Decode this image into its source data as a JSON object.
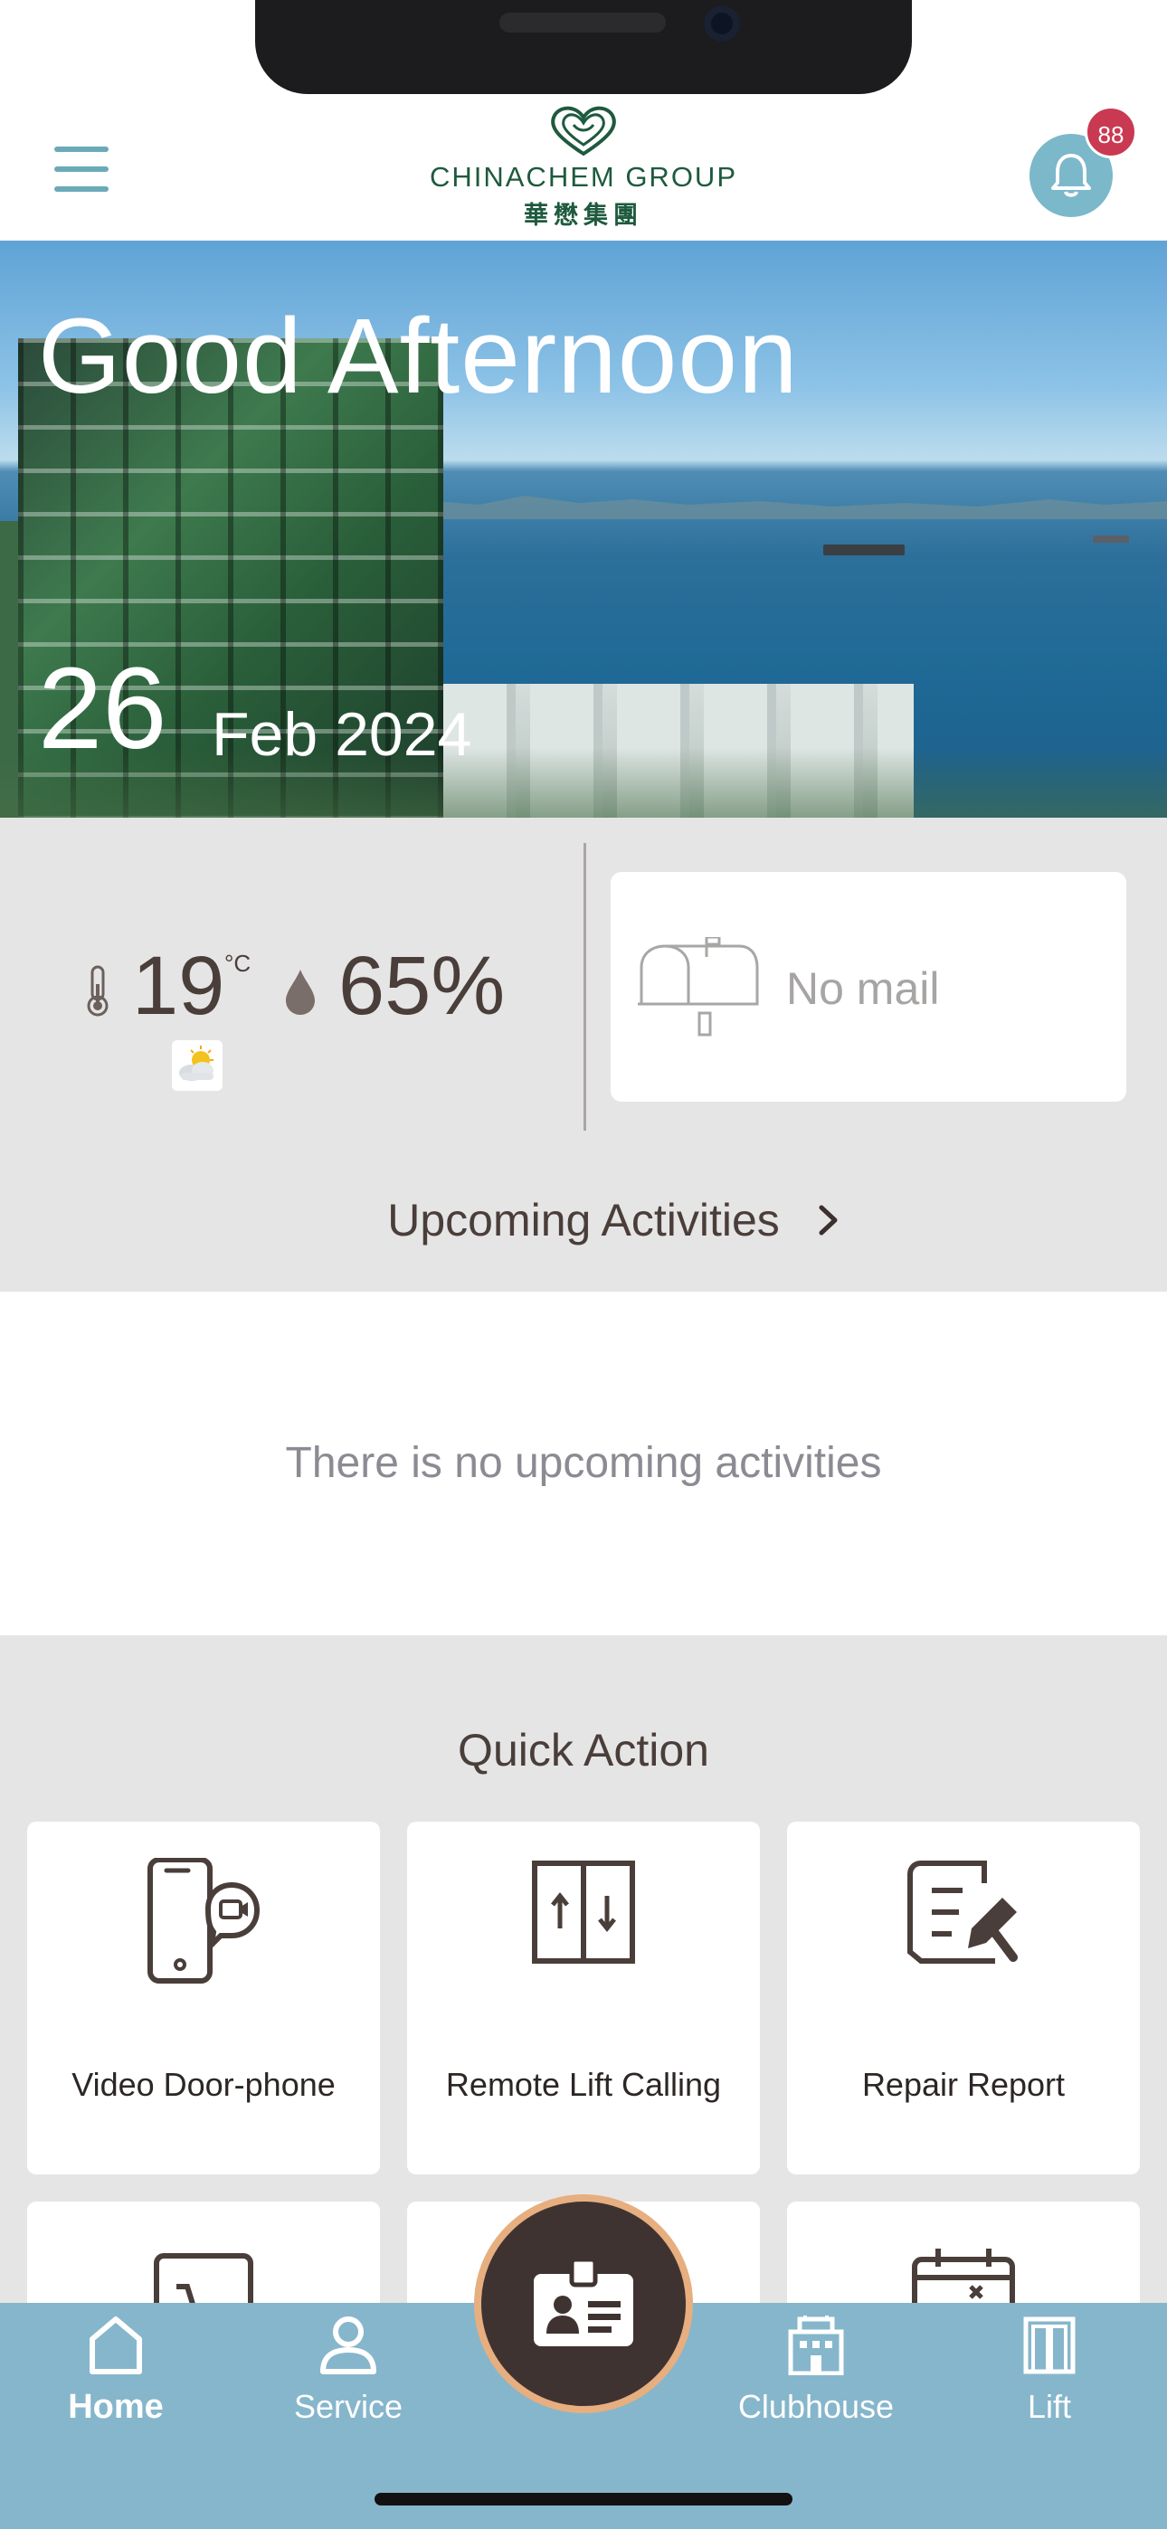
{
  "header": {
    "logo_en": "CHINACHEM GROUP",
    "logo_zh": "華懋集團",
    "notification_count": "88"
  },
  "hero": {
    "greeting": "Good Afternoon",
    "day": "26",
    "month_year": "Feb 2024"
  },
  "weather": {
    "temperature": "19",
    "temperature_unit": "°C",
    "humidity": "65%",
    "condition_icon": "partly-cloudy-icon"
  },
  "mail": {
    "status": "No mail"
  },
  "activities": {
    "title": "Upcoming Activities",
    "empty_message": "There is no upcoming activities"
  },
  "quick_action": {
    "title": "Quick Action",
    "items": [
      {
        "label": "Video Door-phone",
        "icon": "video-door-phone-icon"
      },
      {
        "label": "Remote Lift Calling",
        "icon": "lift-call-icon"
      },
      {
        "label": "Repair Report",
        "icon": "repair-report-icon"
      },
      {
        "label": "",
        "icon": "shopping-cart-icon"
      },
      {
        "label": "",
        "icon": "unknown-icon"
      },
      {
        "label": "",
        "icon": "calendar-booking-icon"
      }
    ]
  },
  "bottom_nav": {
    "items": [
      {
        "label": "Home",
        "active": true
      },
      {
        "label": "Service",
        "active": false
      },
      {
        "label": "Clubhouse",
        "active": false
      },
      {
        "label": "Lift",
        "active": false
      }
    ]
  },
  "colors": {
    "accent_blue": "#86b6cb",
    "badge_red": "#c93a52",
    "brand_green": "#1e5a3e",
    "center_button_ring": "#e7ae80",
    "text_brown": "#4a3e3a"
  }
}
